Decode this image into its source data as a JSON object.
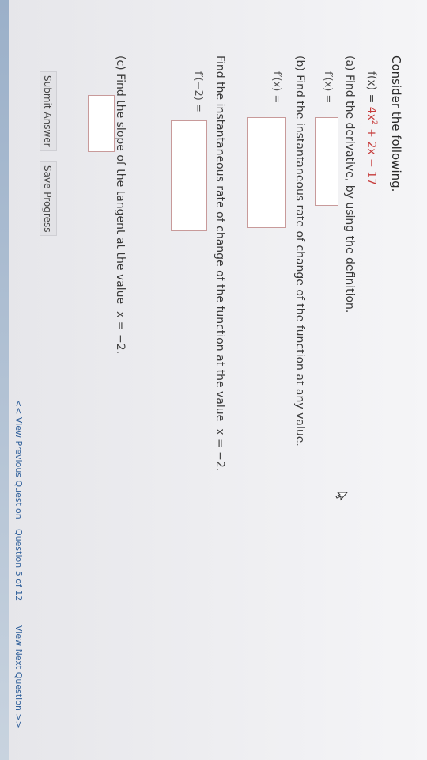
{
  "question": {
    "heading": "Consider the following.",
    "function": {
      "prefix": "f(x) = ",
      "expr_a": "4x",
      "exp": "2",
      "expr_b": " + 2x − 17"
    },
    "part_a": {
      "prompt": "(a) Find the derivative, by using the definition.",
      "label": "f′(x) ="
    },
    "part_b": {
      "prompt": "(b) Find the instantaneous rate of change of the function at any value.",
      "label": "f′(x) =",
      "followup": "Find the instantaneous rate of change of the function at the value",
      "followup_value": "x = −2.",
      "followup_label": "f′(−2) ="
    },
    "part_c": {
      "prompt": "(c) Find the slope of the tangent at the value",
      "value": "x = −2."
    }
  },
  "buttons": {
    "submit": "Submit Answer",
    "save": "Save Progress"
  },
  "footer": {
    "prev": "<< View Previous Question",
    "position": "Question 5 of 12",
    "next": "View Next Question >>"
  },
  "icons": {
    "cursor": "mouse-pointer-icon"
  }
}
